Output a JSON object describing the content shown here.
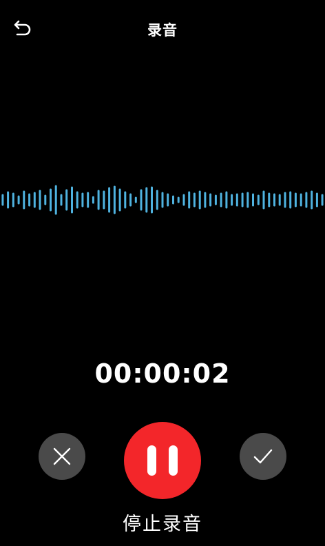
{
  "header": {
    "title": "录音"
  },
  "icons": {
    "back": "undo-arrow-icon",
    "cancel": "close-icon",
    "pause": "pause-icon",
    "confirm": "checkmark-icon"
  },
  "colors": {
    "background": "#000000",
    "waveform": "#4fb3e0",
    "record_button": "#f3262a",
    "secondary_button": "#4a4a4a",
    "text": "#ffffff"
  },
  "recording": {
    "elapsed": "00:00:02",
    "stop_label": "停止录音"
  }
}
